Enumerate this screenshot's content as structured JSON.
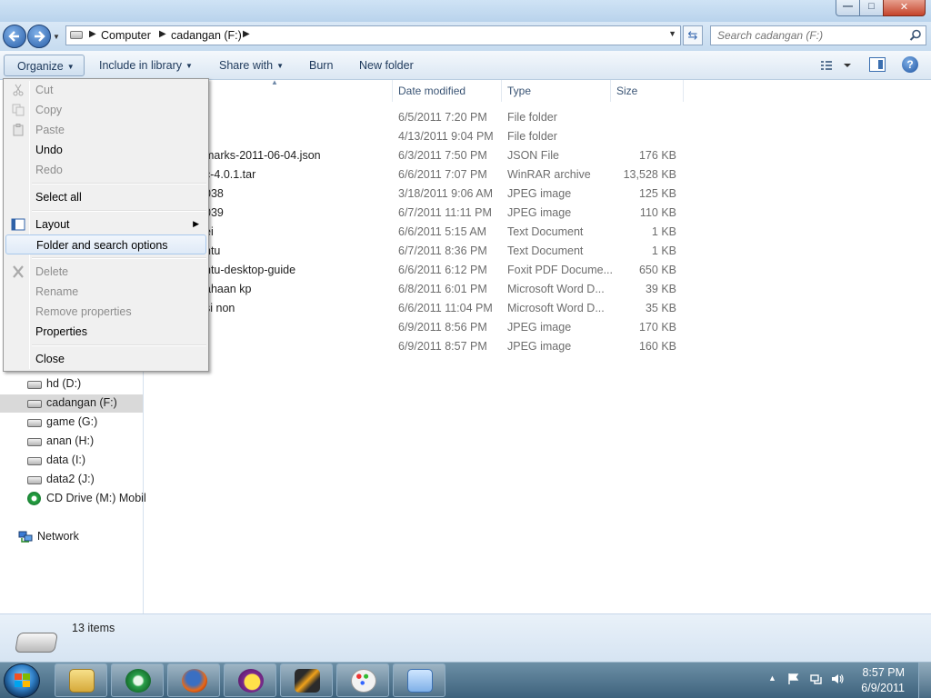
{
  "window": {
    "min_glyph": "—",
    "max_glyph": "□",
    "close_glyph": "✕"
  },
  "address": {
    "crumbs": [
      "Computer",
      "cadangan (F:)"
    ],
    "search_placeholder": "Search cadangan (F:)"
  },
  "toolbar": {
    "organize": "Organize",
    "include": "Include in library",
    "share": "Share with",
    "burn": "Burn",
    "new_folder": "New folder",
    "help": "?"
  },
  "columns": {
    "date": "Date modified",
    "type": "Type",
    "size": "Size"
  },
  "files": [
    {
      "name": "",
      "date": "6/5/2011 7:20 PM",
      "type": "File folder",
      "size": ""
    },
    {
      "name": "r",
      "date": "4/13/2011 9:04 PM",
      "type": "File folder",
      "size": ""
    },
    {
      "name": "marks-2011-06-04.json",
      "date": "6/3/2011 7:50 PM",
      "type": "JSON File",
      "size": "176 KB"
    },
    {
      "name": "c-4.0.1.tar",
      "date": "6/6/2011 7:07 PM",
      "type": "WinRAR archive",
      "size": "13,528 KB"
    },
    {
      "name": "038",
      "date": "3/18/2011 9:06 AM",
      "type": "JPEG image",
      "size": "125 KB"
    },
    {
      "name": "039",
      "date": "6/7/2011 11:11 PM",
      "type": "JPEG image",
      "size": "110 KB"
    },
    {
      "name": "ei",
      "date": "6/6/2011 5:15 AM",
      "type": "Text Document",
      "size": "1 KB"
    },
    {
      "name": "ntu",
      "date": "6/7/2011 8:36 PM",
      "type": "Text Document",
      "size": "1 KB"
    },
    {
      "name": "ntu-desktop-guide",
      "date": "6/6/2011 6:12 PM",
      "type": "Foxit PDF Docume...",
      "size": "650 KB"
    },
    {
      "name": "ahaan kp",
      "date": "6/8/2011 6:01 PM",
      "type": "Microsoft Word D...",
      "size": "39 KB"
    },
    {
      "name": "si non",
      "date": "6/6/2011 11:04 PM",
      "type": "Microsoft Word D...",
      "size": "35 KB"
    },
    {
      "name": "",
      "date": "6/9/2011 8:56 PM",
      "type": "JPEG image",
      "size": "170 KB"
    },
    {
      "name": "",
      "date": "6/9/2011 8:57 PM",
      "type": "JPEG image",
      "size": "160 KB"
    }
  ],
  "menu": {
    "cut": "Cut",
    "copy": "Copy",
    "paste": "Paste",
    "undo": "Undo",
    "redo": "Redo",
    "select_all": "Select all",
    "layout": "Layout",
    "folder_options": "Folder and search options",
    "delete": "Delete",
    "rename": "Rename",
    "remove_props": "Remove properties",
    "properties": "Properties",
    "close": "Close"
  },
  "nav": {
    "drives": [
      "hd (D:)",
      "cadangan (F:)",
      "game (G:)",
      "anan (H:)",
      "data (I:)",
      "data2 (J:)",
      "CD Drive (M:) Mobil"
    ],
    "selected": "cadangan (F:)",
    "network": "Network"
  },
  "details": {
    "count": "13 items"
  },
  "taskbar": {
    "time": "8:57 PM",
    "date": "6/9/2011",
    "pinned": [
      "explorer-icon",
      "phone-manager-icon",
      "firefox-icon",
      "yahoo-messenger-icon",
      "winamp-icon",
      "paint-icon",
      "file-transfer-icon"
    ]
  },
  "colors": {
    "menu_bg": "#f0f0f0",
    "selected_nav": "#d9d9d9",
    "link_blue": "#1e395b",
    "taskbar": "#3e627c"
  }
}
